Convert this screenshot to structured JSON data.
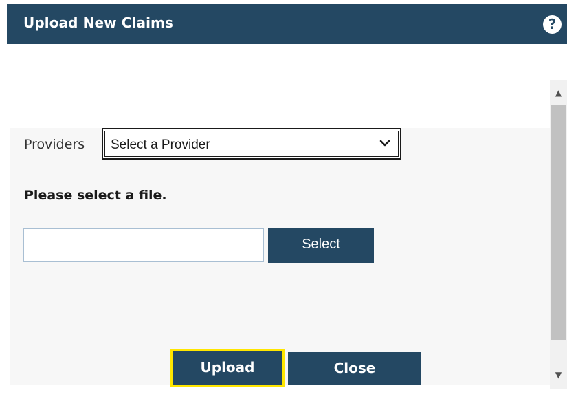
{
  "dialog": {
    "title": "Upload New Claims",
    "help_icon": "question-circle-icon",
    "accent_color": "#244863",
    "focus_color": "#ffe600"
  },
  "form": {
    "providers_label": "Providers",
    "provider_select": {
      "selected": "Select a Provider"
    },
    "file_prompt": "Please select a file.",
    "file_input": {
      "value": "",
      "placeholder": ""
    },
    "select_button_label": "Select"
  },
  "actions": {
    "upload_label": "Upload",
    "close_label": "Close"
  },
  "scrollbar": {
    "up_icon": "scroll-up-arrow-icon",
    "down_icon": "scroll-down-arrow-icon"
  }
}
